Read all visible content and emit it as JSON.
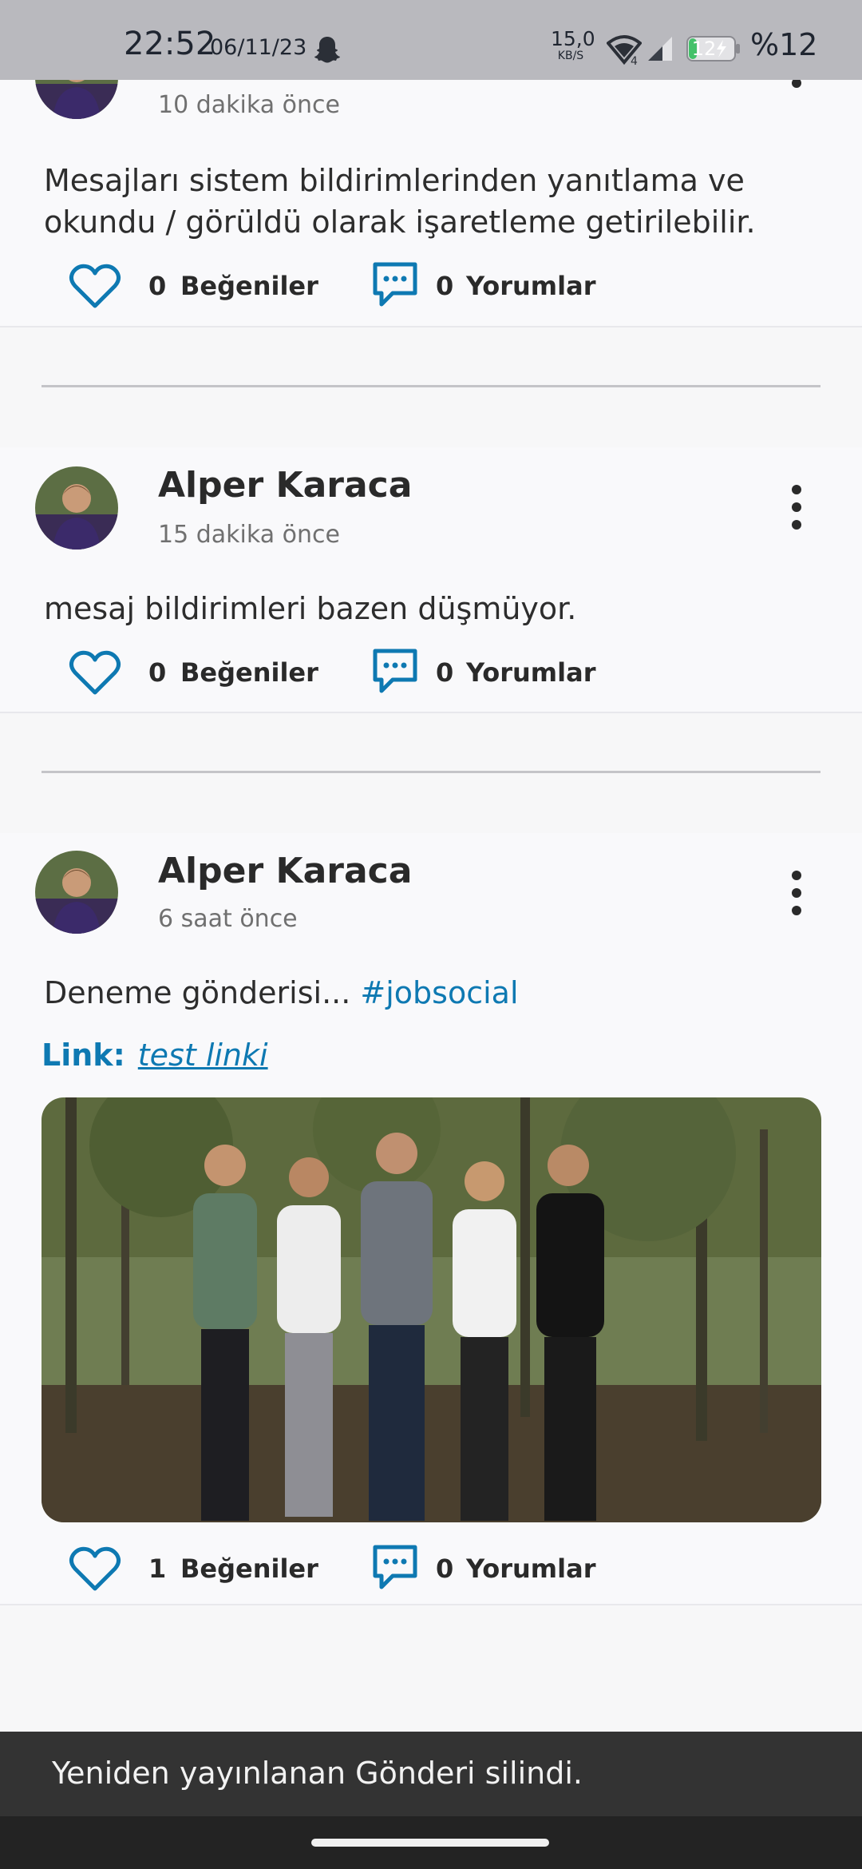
{
  "status_bar": {
    "time": "22:52",
    "date": "06/11/23",
    "net_speed_value": "15,0",
    "net_speed_unit": "KB/S",
    "wifi_badge": "4",
    "battery_level": "12",
    "battery_percent": "%12"
  },
  "posts": [
    {
      "time": "10 dakika önce",
      "text": "Mesajları sistem bildirimlerinden yanıtlama ve okundu / görüldü olarak işaretleme getirilebilir.",
      "likes": "0",
      "likes_label": "Beğeniler",
      "comments": "0",
      "comments_label": "Yorumlar"
    },
    {
      "author": "Alper Karaca",
      "time": "15 dakika önce",
      "text": "mesaj bildirimleri bazen düşmüyor.",
      "likes": "0",
      "likes_label": "Beğeniler",
      "comments": "0",
      "comments_label": "Yorumlar"
    },
    {
      "author": "Alper Karaca",
      "time": "6 saat önce",
      "text": "Deneme gönderisi... ",
      "hashtag": "#jobsocial",
      "link_label": "Link:",
      "link_text": "test linki",
      "likes": "1",
      "likes_label": "Beğeniler",
      "comments": "0",
      "comments_label": "Yorumlar"
    }
  ],
  "snackbar": {
    "message": "Yeniden yayınlanan Gönderi silindi."
  },
  "colors": {
    "accent": "#0e79b2",
    "background": "#f7f7f8",
    "status_bar": "#b9b9be",
    "snackbar": "#333333"
  },
  "icons": {
    "like": "heart-outline-icon",
    "comment": "comment-bubble-icon",
    "menu": "more-vertical-icon",
    "snapchat": "snapchat-ghost-icon",
    "wifi": "wifi-icon",
    "signal": "cell-signal-icon",
    "battery": "battery-charging-icon"
  }
}
